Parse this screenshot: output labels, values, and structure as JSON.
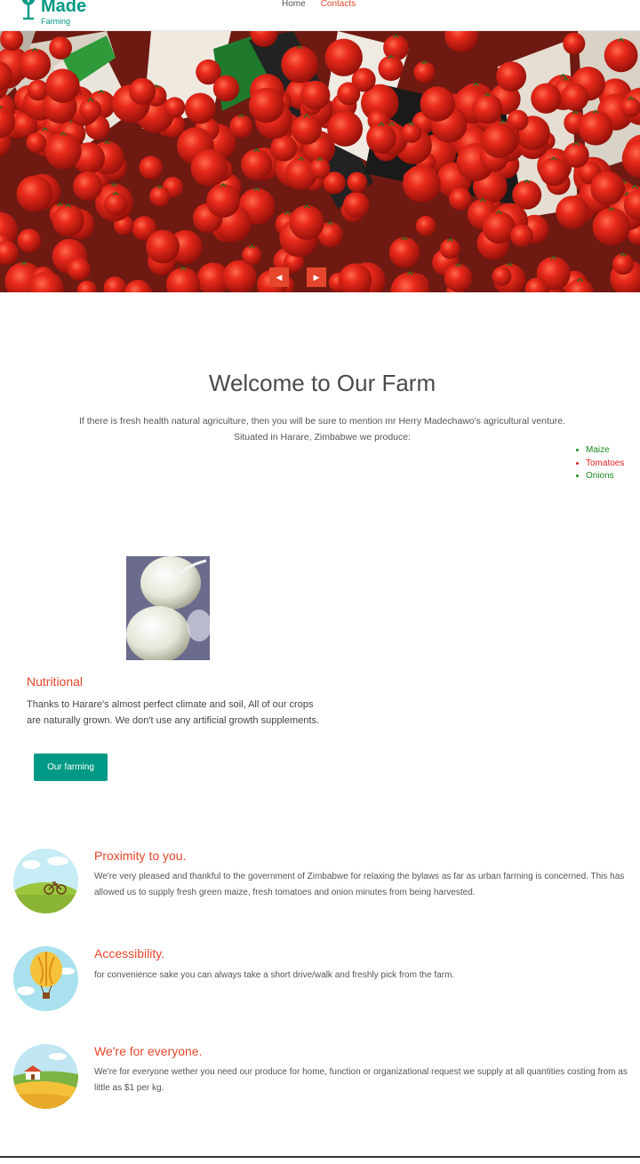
{
  "header": {
    "logo_name": "Made",
    "logo_sub": "Farming",
    "nav": [
      {
        "label": "Home",
        "active": false
      },
      {
        "label": "Contacts",
        "active": true
      }
    ]
  },
  "hero": {
    "prev_icon": "◀",
    "next_icon": "▶"
  },
  "welcome": {
    "title": "Welcome to Our Farm",
    "line1": "If there is fresh health natural agriculture, then you will be sure to mention mr Herry Madechawo's agricultural venture.",
    "line2": "Situated in Harare, Zimbabwe we produce:",
    "produce": [
      {
        "label": "Maize",
        "color": "green"
      },
      {
        "label": "Tomatoes",
        "color": "red"
      },
      {
        "label": "Onions",
        "color": "green"
      }
    ]
  },
  "nutritional": {
    "title": "Nutritional",
    "text": "Thanks to Harare's almost perfect climate and soil, All of our crops are naturally grown. We don't use any artificial growth supplements.",
    "button": "Our farming"
  },
  "features": [
    {
      "title": "Proximity to you.",
      "text": "We're very pleased and thankful to the government of Zimbabwe for relaxing the bylaws as far as urban farming is concerned. This has allowed us to supply fresh green maize, fresh tomatoes and onion minutes from being harvested.",
      "icon": "bicycle-field-icon"
    },
    {
      "title": "Accessibility.",
      "text": "for convenience sake you can always take a short drive/walk and freshly pick from the farm.",
      "icon": "hot-air-balloon-icon"
    },
    {
      "title": "We're for everyone.",
      "text": "We're for everyone wether you need our produce for home, function or organizational request we supply at all quantities costing from as little as $1 per kg.",
      "icon": "farmhouse-field-icon"
    }
  ],
  "colors": {
    "brand": "#009985",
    "accent": "#e4472b"
  }
}
